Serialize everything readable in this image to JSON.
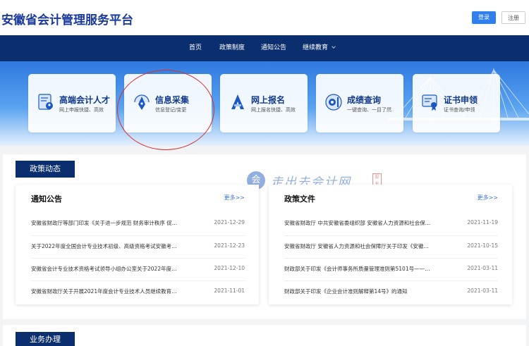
{
  "header": {
    "site_title": "安徽省会计管理服务平台",
    "login_label": "登录",
    "register_label": "注册"
  },
  "nav": {
    "items": [
      "首页",
      "政策制度",
      "通知公告",
      "继续教育"
    ]
  },
  "cards": [
    {
      "title": "高端会计人才",
      "subtitle": "网上申报快捷、高效",
      "icon": "profile-card-icon"
    },
    {
      "title": "信息采集",
      "subtitle": "信息登记/变更",
      "icon": "pen-nib-icon"
    },
    {
      "title": "网上报名",
      "subtitle": "网上报名快捷、高效",
      "icon": "letter-a-icon"
    },
    {
      "title": "成绩查询",
      "subtitle": "一键查询、一目了然",
      "icon": "eye-chart-icon"
    },
    {
      "title": "证书申领",
      "subtitle": "证书查询/申领",
      "icon": "certificate-icon"
    }
  ],
  "policy_section": {
    "title": "政策动态",
    "notices": {
      "title": "通知公告",
      "more": "更多>>",
      "rows": [
        {
          "text": "安徽省财政厅等部门印发《关于进一步规范 财务审计秩序 促…",
          "date": "2021-12-29"
        },
        {
          "text": "关于2022年度全国会计专业技术初级、高级资格考试安徽考…",
          "date": "2021-12-23"
        },
        {
          "text": "安徽省会计专业技术资格考试领导小组办公室关于2022年度…",
          "date": "2021-12-10"
        },
        {
          "text": "安徽省财政厅关于开展2021年度会计专业技术人员继续教育…",
          "date": "2021-11-01"
        }
      ]
    },
    "policies": {
      "title": "政策文件",
      "more": "更多>>",
      "rows": [
        {
          "text": "安徽省财政厅 中共安徽省委组织部 安徽省人力资源和社会保…",
          "date": "2021-11-19"
        },
        {
          "text": "安徽省财政厅 安徽省人力资源和社会保障厅关于印发《安徽…",
          "date": "2021-10-15"
        },
        {
          "text": "财政部关于印发《会计师事务所质量管理准则第5101号——…",
          "date": "2021-03-11"
        },
        {
          "text": "财政部关于印发《企业会计准则解释第14号》的通知",
          "date": "2021-03-11"
        }
      ]
    }
  },
  "watermark": {
    "text": "走出去会计网",
    "seal": "股东"
  },
  "business_section": {
    "title": "业务办理"
  },
  "colors": {
    "navy": "#0b2f6e",
    "brand_blue": "#1a3aa0",
    "button_blue": "#2f80ed",
    "highlight_red": "#d93030"
  }
}
